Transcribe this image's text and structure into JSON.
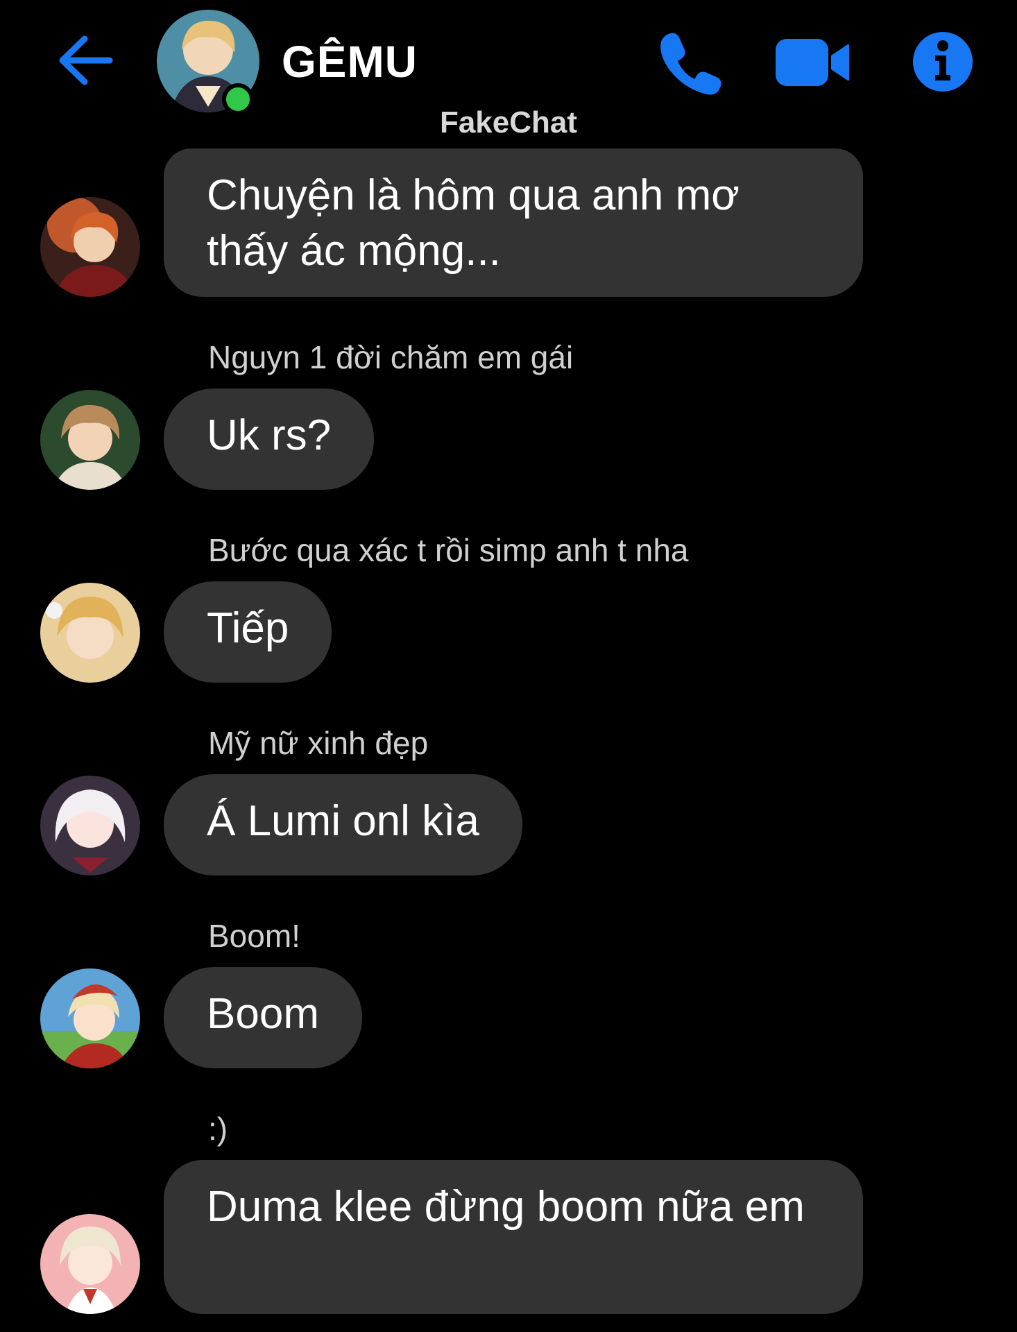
{
  "header": {
    "group_name": "GÊMU",
    "watermark": "FakeChat",
    "icons": [
      "back-arrow-icon",
      "phone-icon",
      "video-camera-icon",
      "info-icon"
    ],
    "accent_color": "#1877f2",
    "online_color": "#31c84a"
  },
  "messages": [
    {
      "sender": "",
      "text": "Chuyện là hôm qua anh mơ thấy ác mộng...",
      "avatar_tone": "#b04a2a"
    },
    {
      "sender": "Nguyn 1 đời chăm em gái",
      "text": "Uk rs?",
      "avatar_tone": "#7a5a3a"
    },
    {
      "sender": "Bước qua xác t rồi simp anh t nha",
      "text": "Tiếp",
      "avatar_tone": "#d9b26a"
    },
    {
      "sender": "Mỹ nữ xinh đẹp",
      "text": "Á Lumi onl kìa",
      "avatar_tone": "#e8dfe8"
    },
    {
      "sender": "Boom!",
      "text": "Boom",
      "avatar_tone": "#c94a3a"
    },
    {
      "sender": ":)",
      "text": "Duma klee đừng boom nữa em",
      "avatar_tone": "#f0b6b8"
    }
  ]
}
